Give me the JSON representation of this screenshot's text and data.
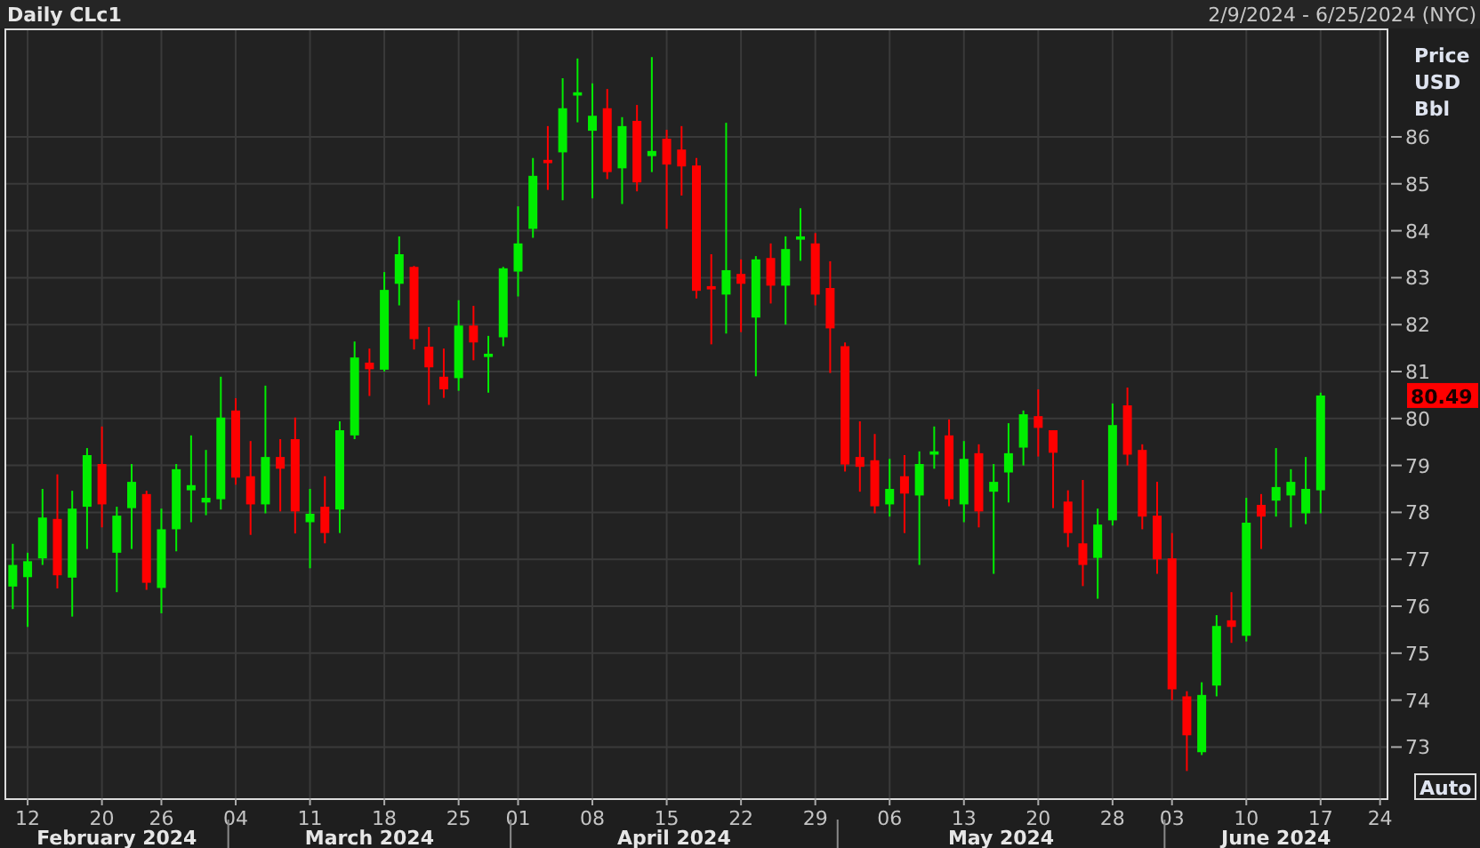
{
  "header": {
    "title": "Daily CLc1",
    "date_range": "2/9/2024 - 6/25/2024 (NYC)"
  },
  "chart": {
    "unit_label": [
      "Price",
      "USD",
      "Bbl"
    ],
    "last_price": "80.49",
    "scale_button": "Auto",
    "months": [
      "February 2024",
      "March 2024",
      "April 2024",
      "May 2024",
      "June 2024"
    ],
    "chart_data": {
      "type": "candlestick",
      "grid": true,
      "ylim": [
        71.91,
        88.31
      ],
      "yticks": [
        73,
        74,
        75,
        76,
        77,
        78,
        79,
        80,
        81,
        82,
        83,
        84,
        85,
        86
      ],
      "categories": [
        null,
        "12",
        null,
        null,
        null,
        null,
        "20",
        null,
        null,
        null,
        "26",
        null,
        null,
        null,
        null,
        "04",
        null,
        null,
        null,
        null,
        "11",
        null,
        null,
        null,
        null,
        "18",
        null,
        null,
        null,
        null,
        "25",
        null,
        null,
        null,
        "01",
        null,
        null,
        null,
        null,
        "08",
        null,
        null,
        null,
        null,
        "15",
        null,
        null,
        null,
        null,
        "22",
        null,
        null,
        null,
        null,
        "29",
        null,
        null,
        null,
        null,
        "06",
        null,
        null,
        null,
        null,
        "13",
        null,
        null,
        null,
        null,
        "20",
        null,
        null,
        null,
        null,
        "28",
        null,
        null,
        null,
        "03",
        null,
        null,
        null,
        null,
        "10",
        null,
        null,
        null,
        null,
        "17",
        null,
        null,
        null,
        "24"
      ],
      "ohlc": [
        [
          76.42,
          77.33,
          75.94,
          76.88
        ],
        [
          76.62,
          77.14,
          75.56,
          76.96
        ],
        [
          77.02,
          78.5,
          76.88,
          77.89
        ],
        [
          77.86,
          78.81,
          76.38,
          76.66
        ],
        [
          76.61,
          78.46,
          75.78,
          78.08
        ],
        [
          78.12,
          79.37,
          77.22,
          79.22
        ],
        [
          79.03,
          79.83,
          77.68,
          78.17
        ],
        [
          77.14,
          78.12,
          76.3,
          77.93
        ],
        [
          78.09,
          79.03,
          77.22,
          78.65
        ],
        [
          78.39,
          78.46,
          76.35,
          76.5
        ],
        [
          76.39,
          78.08,
          75.85,
          77.64
        ],
        [
          77.64,
          79.03,
          77.17,
          78.92
        ],
        [
          78.47,
          79.64,
          77.79,
          78.58
        ],
        [
          78.21,
          79.33,
          77.94,
          78.31
        ],
        [
          78.28,
          80.89,
          78.06,
          80.02
        ],
        [
          80.17,
          80.43,
          78.59,
          78.74
        ],
        [
          78.77,
          79.52,
          77.52,
          78.17
        ],
        [
          78.17,
          80.7,
          77.98,
          79.18
        ],
        [
          79.18,
          79.56,
          78.02,
          78.93
        ],
        [
          79.56,
          80.02,
          77.55,
          78.02
        ],
        [
          77.79,
          78.5,
          76.81,
          77.97
        ],
        [
          78.12,
          78.77,
          77.34,
          77.56
        ],
        [
          78.06,
          79.94,
          77.56,
          79.75
        ],
        [
          79.64,
          81.64,
          79.56,
          81.3
        ],
        [
          81.19,
          81.49,
          80.48,
          81.05
        ],
        [
          81.04,
          83.12,
          81.0,
          82.74
        ],
        [
          82.87,
          83.88,
          82.41,
          83.5
        ],
        [
          83.23,
          83.25,
          81.47,
          81.69
        ],
        [
          81.53,
          81.95,
          80.29,
          81.09
        ],
        [
          80.89,
          81.49,
          80.44,
          80.62
        ],
        [
          80.86,
          82.52,
          80.59,
          81.98
        ],
        [
          81.98,
          82.4,
          81.24,
          81.62
        ],
        [
          81.31,
          81.76,
          80.55,
          81.38
        ],
        [
          81.73,
          83.23,
          81.54,
          83.2
        ],
        [
          83.13,
          84.52,
          82.6,
          83.73
        ],
        [
          84.04,
          85.55,
          83.85,
          85.17
        ],
        [
          85.51,
          86.23,
          84.87,
          85.44
        ],
        [
          85.67,
          87.25,
          84.65,
          86.61
        ],
        [
          86.88,
          87.67,
          86.31,
          86.95
        ],
        [
          86.13,
          87.14,
          84.69,
          86.45
        ],
        [
          86.61,
          87.02,
          85.1,
          85.25
        ],
        [
          85.33,
          86.42,
          84.57,
          86.23
        ],
        [
          86.34,
          86.68,
          84.84,
          85.03
        ],
        [
          85.59,
          87.7,
          85.25,
          85.7
        ],
        [
          85.96,
          86.15,
          84.04,
          85.41
        ],
        [
          85.73,
          86.23,
          84.75,
          85.37
        ],
        [
          85.39,
          85.55,
          82.56,
          82.72
        ],
        [
          82.82,
          83.5,
          81.58,
          82.75
        ],
        [
          82.64,
          86.3,
          81.81,
          83.16
        ],
        [
          83.08,
          83.39,
          81.84,
          82.87
        ],
        [
          82.15,
          83.46,
          80.9,
          83.39
        ],
        [
          83.42,
          83.73,
          82.45,
          82.83
        ],
        [
          82.83,
          83.88,
          82.0,
          83.61
        ],
        [
          83.81,
          84.48,
          83.36,
          83.88
        ],
        [
          83.73,
          83.95,
          82.41,
          82.64
        ],
        [
          82.78,
          83.35,
          80.97,
          81.92
        ],
        [
          81.54,
          81.62,
          78.87,
          79.02
        ],
        [
          79.18,
          79.94,
          78.44,
          78.97
        ],
        [
          79.11,
          79.67,
          77.98,
          78.13
        ],
        [
          78.17,
          79.14,
          77.91,
          78.5
        ],
        [
          78.77,
          79.22,
          77.56,
          78.4
        ],
        [
          78.36,
          79.3,
          76.88,
          79.03
        ],
        [
          79.23,
          79.83,
          78.93,
          79.3
        ],
        [
          79.64,
          79.98,
          78.13,
          78.28
        ],
        [
          78.17,
          79.52,
          77.79,
          79.14
        ],
        [
          79.26,
          79.45,
          77.68,
          78.02
        ],
        [
          78.44,
          79.03,
          76.69,
          78.65
        ],
        [
          78.85,
          79.9,
          78.21,
          79.26
        ],
        [
          79.38,
          80.17,
          79.0,
          80.09
        ],
        [
          80.05,
          80.62,
          79.19,
          79.8
        ],
        [
          79.75,
          79.75,
          78.09,
          79.27
        ],
        [
          78.23,
          78.47,
          77.26,
          77.56
        ],
        [
          77.34,
          78.69,
          76.43,
          76.88
        ],
        [
          77.03,
          78.08,
          76.16,
          77.74
        ],
        [
          77.83,
          80.32,
          77.72,
          79.86
        ],
        [
          80.28,
          80.66,
          79.0,
          79.23
        ],
        [
          79.33,
          79.45,
          77.64,
          77.91
        ],
        [
          77.93,
          78.65,
          76.69,
          77.0
        ],
        [
          77.02,
          77.56,
          74.0,
          74.23
        ],
        [
          74.08,
          74.19,
          72.49,
          73.25
        ],
        [
          72.89,
          74.38,
          72.83,
          74.11
        ],
        [
          74.31,
          75.81,
          74.08,
          75.58
        ],
        [
          75.7,
          76.3,
          75.22,
          75.56
        ],
        [
          75.37,
          78.31,
          75.25,
          77.78
        ],
        [
          78.16,
          78.39,
          77.22,
          77.91
        ],
        [
          78.25,
          79.37,
          77.91,
          78.54
        ],
        [
          78.36,
          78.92,
          77.68,
          78.65
        ],
        [
          77.98,
          79.18,
          77.75,
          78.5
        ],
        [
          78.47,
          80.55,
          77.98,
          80.49
        ],
        null,
        null,
        null,
        null
      ]
    }
  }
}
